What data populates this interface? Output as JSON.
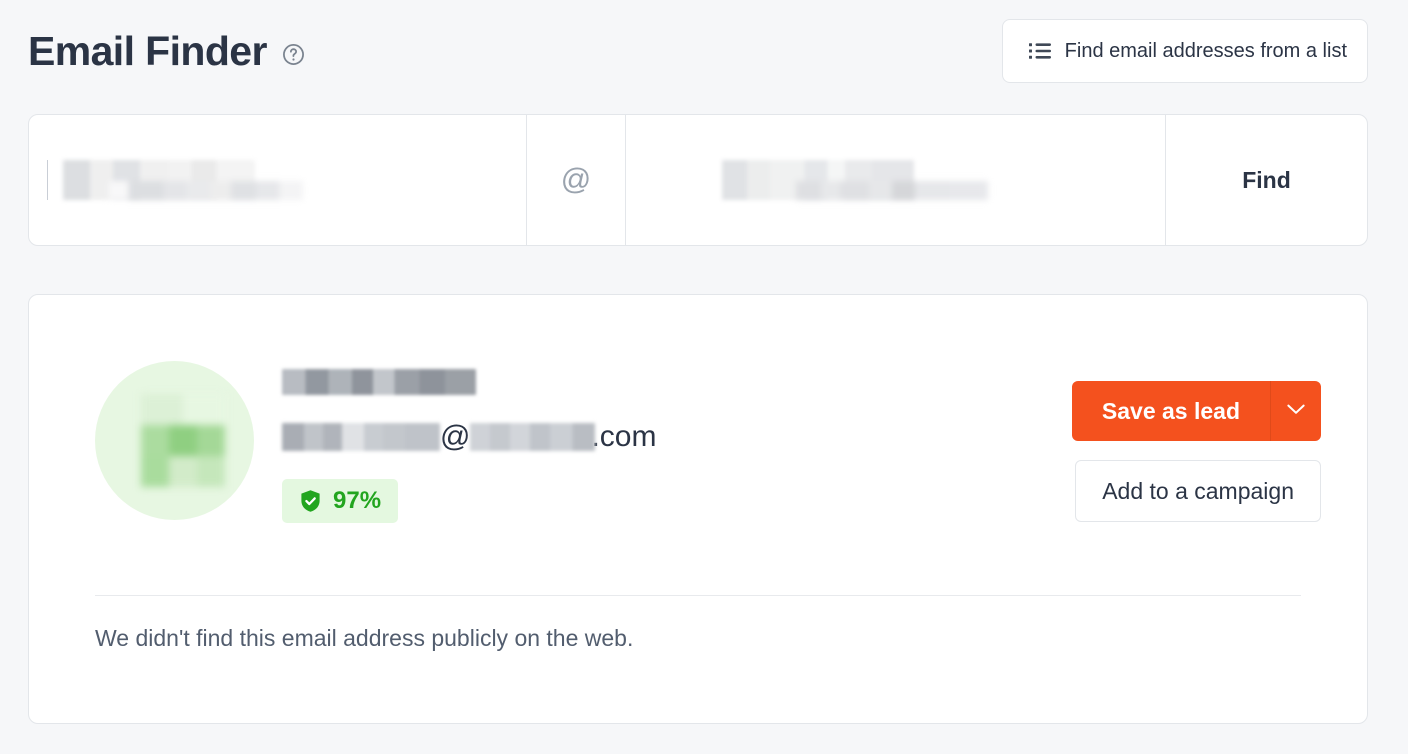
{
  "header": {
    "title": "Email Finder",
    "help_icon": "question-circle-icon",
    "list_button": {
      "label": "Find email addresses from a list",
      "icon": "bulleted-list-icon"
    }
  },
  "search": {
    "name_field": {
      "value": "",
      "placeholder": "",
      "redacted": true
    },
    "separator": "@",
    "domain_field": {
      "value": "",
      "placeholder": "",
      "redacted": true
    },
    "find_button_label": "Find"
  },
  "result": {
    "avatar": "contact-avatar-redacted",
    "full_name": "",
    "email": {
      "local_part": "",
      "at": "@",
      "domain": "",
      "tld": ".com"
    },
    "confidence": {
      "icon": "shield-check-icon",
      "value": "97%"
    },
    "actions": {
      "save_label": "Save as lead",
      "dropdown_icon": "chevron-down-icon",
      "campaign_label": "Add to a campaign"
    },
    "no_sources_message": "We didn't find this email address publicly on the web."
  },
  "colors": {
    "page_background": "#f6f7f9",
    "card_background": "#ffffff",
    "border": "#e3e6ea",
    "text_primary": "#2b3445",
    "text_secondary": "#525d6e",
    "accent_orange": "#f4511e",
    "confidence_green": "#22a51f",
    "confidence_green_bg": "#e4f8e0",
    "avatar_green_bg": "#e7f7e2"
  }
}
